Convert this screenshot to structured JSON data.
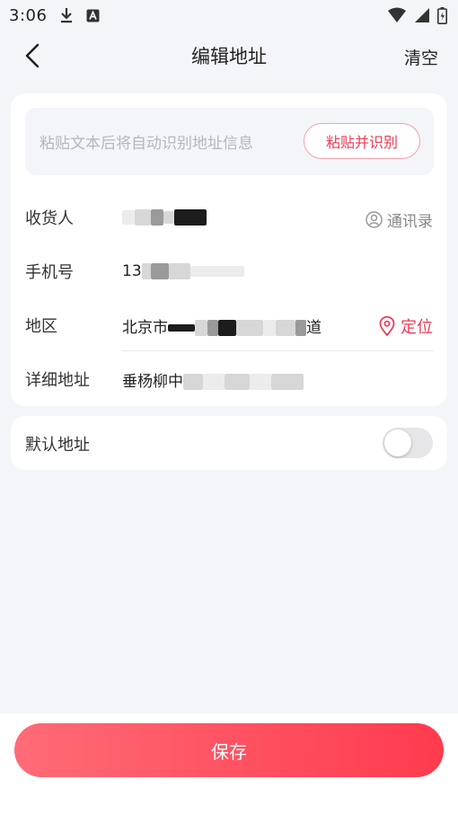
{
  "status_bar": {
    "time": "3:06",
    "icons": [
      "download-icon",
      "a-badge-icon",
      "wifi-icon",
      "signal-icon",
      "battery-icon"
    ]
  },
  "nav": {
    "back_icon": "chevron-left-icon",
    "title": "编辑地址",
    "clear_label": "清空"
  },
  "paste": {
    "hint": "粘贴文本后将自动识别地址信息",
    "button_label": "粘贴并识别"
  },
  "form": {
    "recipient": {
      "label": "收货人",
      "value_redacted": true,
      "contacts_label": "通讯录",
      "contacts_icon": "contact-person-icon"
    },
    "phone": {
      "label": "手机号",
      "value_prefix": "13"
    },
    "region": {
      "label": "地区",
      "value_start": "北京市",
      "value_end": "道",
      "locate_label": "定位",
      "locate_icon": "location-pin-icon"
    },
    "detail": {
      "label": "详细地址",
      "value_start": "垂杨柳中"
    }
  },
  "default_address": {
    "label": "默认地址",
    "enabled": false
  },
  "save_label": "保存",
  "colors": {
    "accent": "#f23a52",
    "save_gradient_start": "#ff6b77",
    "save_gradient_end": "#ff3b4e",
    "background": "#f4f5f9"
  }
}
